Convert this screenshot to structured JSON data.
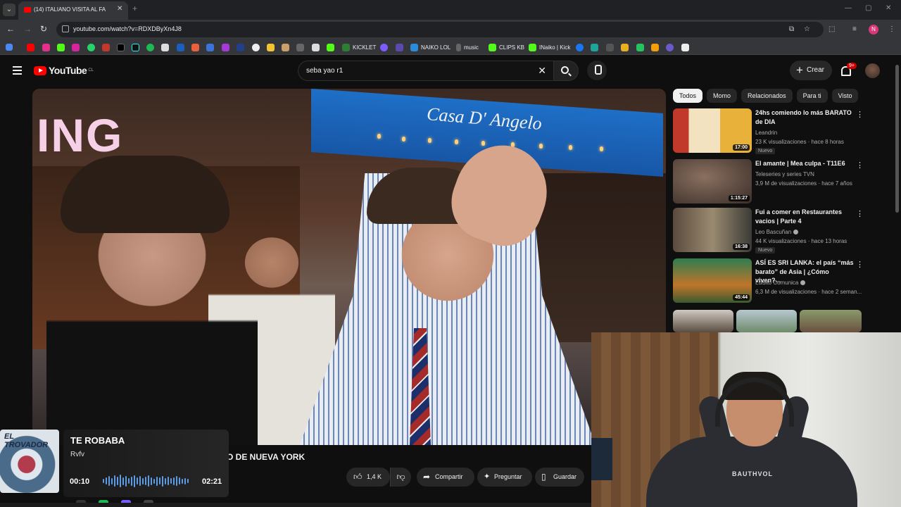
{
  "browser": {
    "tab_title": "(14) ITALIANO VISITA AL FA",
    "url": "youtube.com/watch?v=RDXDByXn4J8",
    "profile_initial": "N",
    "bookmarks": [
      "KICKLET",
      "NAIKO LOL",
      "music",
      "CLIPS KB",
      "INaiko | Kick"
    ]
  },
  "header": {
    "logo_text": "YouTube",
    "country": "CL",
    "search_query": "seba yao r1",
    "create_label": "Crear",
    "notif_count": "9+"
  },
  "chips": [
    "Todos",
    "Momo",
    "Relacionados",
    "Para ti",
    "Visto"
  ],
  "recommendations": [
    {
      "title": "24hs comiendo lo más BARATO de DIA",
      "channel": "Leandrin",
      "meta": "23 K visualizaciones · hace 8 horas",
      "badge": "Nuevo",
      "duration": "17:00",
      "thumb_color": "#c9a46a"
    },
    {
      "title": "El amante | Mea culpa - T11E6",
      "channel": "Teleseries y series TVN",
      "meta": "3,9 M de visualizaciones · hace 7 años",
      "badge": "",
      "duration": "1:15:27",
      "thumb_color": "#5a4a3e"
    },
    {
      "title": "Fui a comer en Restaurantes vacios | Parte 4",
      "channel": "Leo Bascuñan",
      "meta": "44 K visualizaciones · hace 13 horas",
      "badge": "Nuevo",
      "duration": "16:38",
      "thumb_color": "#7a6a55"
    },
    {
      "title": "ASÍ ES SRI LANKA: el país “más barato” de Asia | ¿Cómo viven?...",
      "channel": "Luisito Comunica",
      "meta": "6,3 M de visualizaciones · hace 2 seman...",
      "badge": "",
      "duration": "45:44",
      "thumb_color": "#3f6a3a"
    }
  ],
  "video": {
    "title_visible": "O DE NUEVA YORK",
    "overlay_text": "ING",
    "awning_text": "Casa D' Angelo"
  },
  "actions": {
    "likes": "1,4 K",
    "share": "Compartir",
    "ask": "Preguntar",
    "save": "Guardar"
  },
  "music": {
    "song": "TE ROBABA",
    "artist": "Rvfv",
    "elapsed": "00:10",
    "total": "02:21",
    "cover_text": "EL TROVADOR"
  },
  "webcam": {
    "hoodie_text": "BAUTHVOL"
  }
}
